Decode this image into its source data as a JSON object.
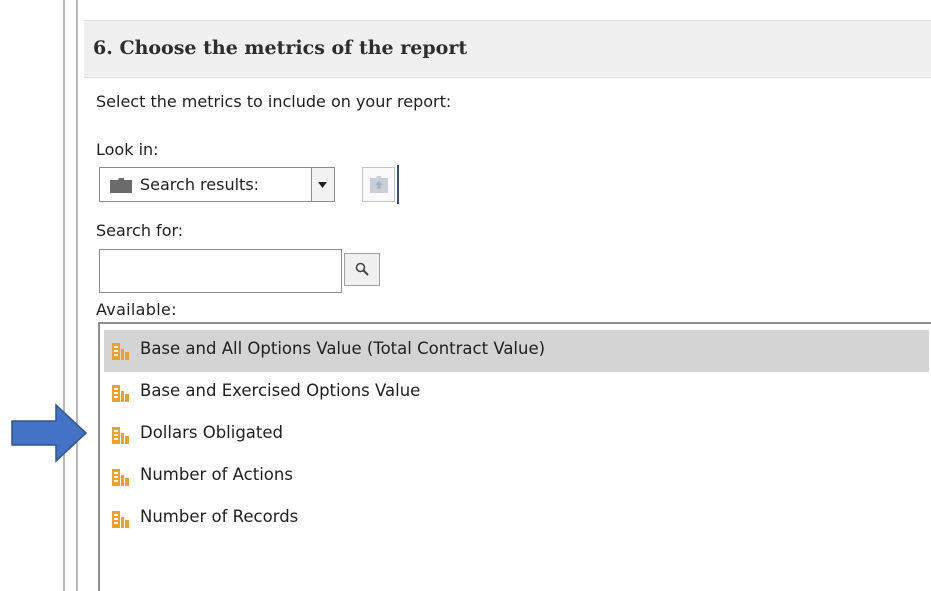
{
  "section": {
    "title": "6. Choose the metrics of the report",
    "instruction": "Select the metrics to include on your report:"
  },
  "look_in": {
    "label": "Look in:",
    "value": "Search results:"
  },
  "search": {
    "label": "Search for:",
    "value": "",
    "placeholder": ""
  },
  "available": {
    "label": "Available:",
    "items": [
      {
        "label": "Base and All Options Value (Total Contract Value)",
        "selected": true
      },
      {
        "label": "Base and Exercised Options Value",
        "selected": false
      },
      {
        "label": "Dollars Obligated",
        "selected": false
      },
      {
        "label": "Number of Actions",
        "selected": false
      },
      {
        "label": "Number of Records",
        "selected": false
      }
    ]
  },
  "icons": {
    "look_in": "folder-icon",
    "dropdown": "chevron-down-icon",
    "parent_folder": "folder-up-icon",
    "search_button": "search-icon",
    "metric": "metric-icon",
    "pointer": "arrow-right-icon"
  },
  "colors": {
    "metric_icon": "#f0a028",
    "selected_row": "#d4d4d4",
    "pointer_arrow": "#4472c4",
    "header_bg": "#f0f0f0"
  }
}
